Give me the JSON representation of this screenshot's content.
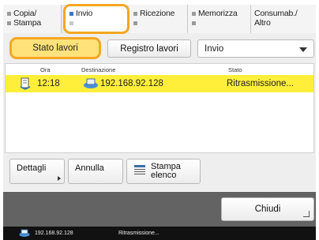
{
  "tabs": [
    {
      "line1": "Copia/",
      "line2": "Stampa",
      "active": false
    },
    {
      "line1": "Invio",
      "line2": "",
      "active": true
    },
    {
      "line1": "Ricezione",
      "line2": "",
      "active": false
    },
    {
      "line1": "Memorizza",
      "line2": "",
      "active": false
    },
    {
      "line1": "Consumab./",
      "line2": "Altro",
      "active": false
    }
  ],
  "toolbar": {
    "stato_label": "Stato lavori",
    "registro_label": "Registro lavori",
    "dropdown_value": "Invio"
  },
  "table": {
    "headers": {
      "ora": "Ora",
      "destinazione": "Destinazione",
      "stato": "Stato"
    },
    "rows": [
      {
        "ora": "12:18",
        "destinazione": "192.168.92.128",
        "stato": "Ritrasmissione..."
      }
    ]
  },
  "actions": {
    "dettagli": "Dettagli",
    "annulla": "Annulla",
    "stampa": "Stampa\nelenco"
  },
  "footer": {
    "chiudi": "Chiudi"
  },
  "statusbar": {
    "address": "192.168.92.128",
    "status": "Ritrasmissione..."
  },
  "colors": {
    "highlight_orange": "#f5a623",
    "selected_row": "#ffef3a",
    "selected_button": "#ffe27a",
    "active_tab_marker": "#3a76c7"
  },
  "icons": {
    "dropdown": "chevron-down-icon",
    "job_row": "document-send-icon",
    "destination": "network-pc-icon",
    "print_list": "printer-list-icon"
  }
}
